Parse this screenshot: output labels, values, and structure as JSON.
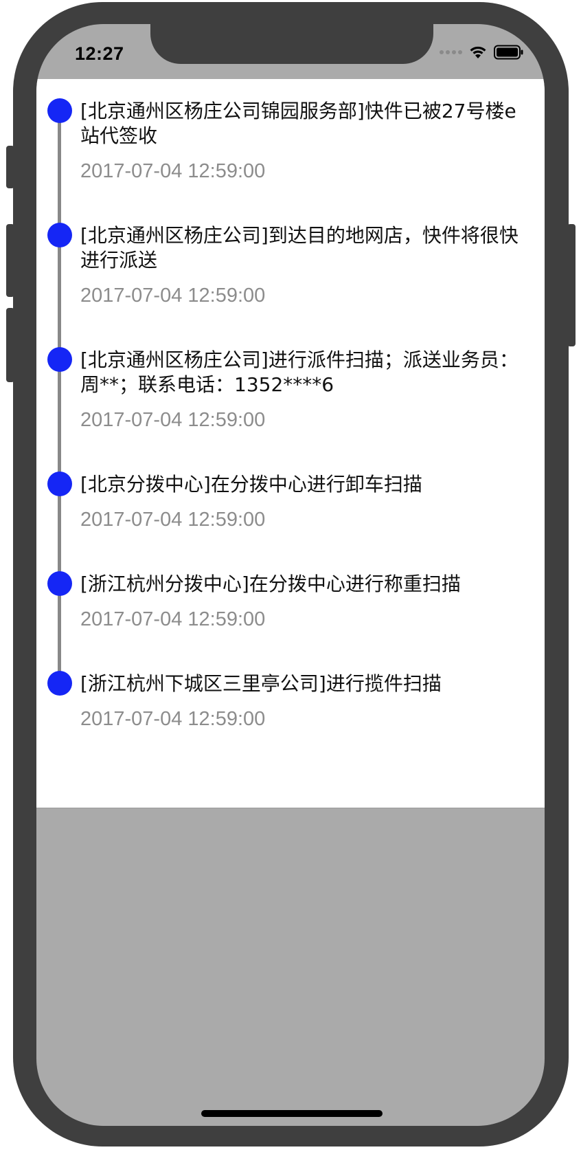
{
  "status_bar": {
    "time": "12:27",
    "icons": [
      "signal-dots-icon",
      "wifi-icon",
      "battery-icon"
    ]
  },
  "colors": {
    "timeline_dot": "#1526f5",
    "timeline_line": "#888888",
    "title_text": "#111111",
    "time_text": "#8c8c8c",
    "screen_bg": "#aaaaaa",
    "phone_frame": "#3f3f3f"
  },
  "timeline": {
    "items": [
      {
        "title": "[北京通州区杨庄公司锦园服务部]快件已被27号楼e站代签收",
        "time": "2017-07-04 12:59:00"
      },
      {
        "title": "[北京通州区杨庄公司]到达目的地网店，快件将很快进行派送",
        "time": "2017-07-04 12:59:00"
      },
      {
        "title": "[北京通州区杨庄公司]进行派件扫描；派送业务员：周**；联系电话：1352****6",
        "time": "2017-07-04 12:59:00"
      },
      {
        "title": "[北京分拨中心]在分拨中心进行卸车扫描",
        "time": "2017-07-04 12:59:00"
      },
      {
        "title": "[浙江杭州分拨中心]在分拨中心进行称重扫描",
        "time": "2017-07-04 12:59:00"
      },
      {
        "title": "[浙江杭州下城区三里亭公司]进行揽件扫描",
        "time": "2017-07-04 12:59:00"
      }
    ]
  }
}
